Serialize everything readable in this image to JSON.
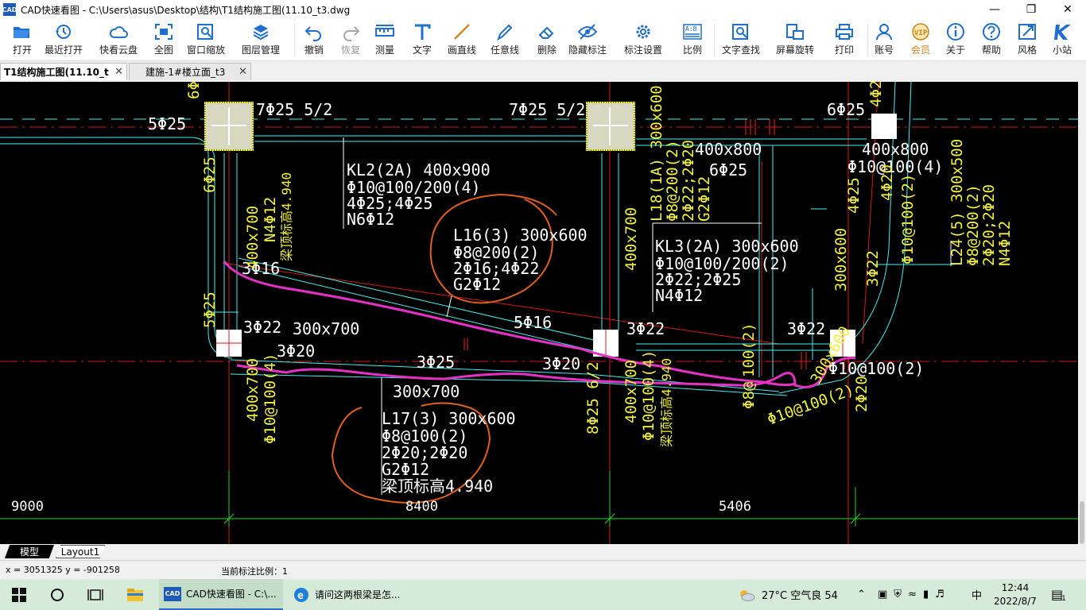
{
  "window": {
    "title": "CAD快速看图 - C:\\Users\\asus\\Desktop\\结构\\T1结构施工图(11.10_t3.dwg",
    "logo_text": "CAD"
  },
  "toolbar": [
    {
      "id": "open",
      "label": "打开",
      "icon": "folder-open-icon"
    },
    {
      "id": "recent",
      "label": "最近打开",
      "icon": "history-icon"
    },
    {
      "id": "cloud",
      "label": "快看云盘",
      "icon": "cloud-icon"
    },
    {
      "id": "fullview",
      "label": "全图",
      "icon": "fit-extents-icon"
    },
    {
      "id": "zoomwin",
      "label": "窗口缩放",
      "icon": "zoom-window-icon"
    },
    {
      "id": "layers",
      "label": "图层管理",
      "icon": "layers-icon"
    },
    {
      "id": "undo",
      "label": "撤销",
      "icon": "undo-icon"
    },
    {
      "id": "redo",
      "label": "恢复",
      "icon": "redo-icon",
      "disabled": true
    },
    {
      "id": "measure",
      "label": "测量",
      "icon": "ruler-icon"
    },
    {
      "id": "text",
      "label": "文字",
      "icon": "text-icon"
    },
    {
      "id": "line",
      "label": "画直线",
      "icon": "line-icon"
    },
    {
      "id": "freeline",
      "label": "任意线",
      "icon": "pen-icon"
    },
    {
      "id": "erase",
      "label": "删除",
      "icon": "eraser-icon"
    },
    {
      "id": "hidemarks",
      "label": "隐藏标注",
      "icon": "eye-hide-icon"
    },
    {
      "id": "marksettings",
      "label": "标注设置",
      "icon": "settings-icon"
    },
    {
      "id": "scale",
      "label": "比例",
      "icon": "scale-icon"
    },
    {
      "id": "findtext",
      "label": "文字查找",
      "icon": "find-text-icon"
    },
    {
      "id": "rotate",
      "label": "屏幕旋转",
      "icon": "rotate-screen-icon"
    },
    {
      "id": "print",
      "label": "打印",
      "icon": "printer-icon"
    },
    {
      "id": "account",
      "label": "账号",
      "icon": "user-icon"
    },
    {
      "id": "vip",
      "label": "会员",
      "icon": "vip-icon",
      "badge": "VIP"
    },
    {
      "id": "about",
      "label": "关于",
      "icon": "info-icon"
    },
    {
      "id": "help",
      "label": "帮助",
      "icon": "help-icon"
    },
    {
      "id": "style",
      "label": "风格",
      "icon": "style-icon"
    },
    {
      "id": "site",
      "label": "小站",
      "icon": "site-icon"
    }
  ],
  "scale_icon_text": "A:B",
  "tabs": [
    {
      "label": "T1结构施工图(11.10_t",
      "active": true
    },
    {
      "label": "建施-1#楼立面_t3",
      "active": false
    }
  ],
  "tab_close": "✕",
  "layout_tabs": {
    "model": "模型",
    "layout": "Layout1"
  },
  "status": {
    "coords": "x = 3051325  y = -901258",
    "scale": "当前标注比例：1"
  },
  "taskbar": {
    "apps": [
      {
        "label": "CAD快速看图 - C:\\...",
        "active": true
      },
      {
        "label": "请问这两根梁是怎...",
        "active": false
      }
    ],
    "weather": "27°C  空气良 54",
    "ime": "中",
    "time": "12:44",
    "date": "2022/8/7",
    "notif_count": "1"
  },
  "drawing": {
    "colors": {
      "cyan": "#3ff0f0",
      "yellow": "#f0f040",
      "white": "#ffffff",
      "red": "#d81818",
      "green": "#2ed02e",
      "magenta": "#e830c8",
      "orange": "#e0601a"
    },
    "white_labels": [
      {
        "t": "5Φ25"
      },
      {
        "t": "7Φ25 5/2"
      },
      {
        "t": "7Φ25 5/2"
      },
      {
        "t": "6Φ25"
      },
      {
        "t": "KL2(2A) 400x900"
      },
      {
        "t": "Φ10@100/200(4)"
      },
      {
        "t": "4Φ25;4Φ25"
      },
      {
        "t": "N6Φ12"
      },
      {
        "t": "L16(3) 300x600"
      },
      {
        "t": "Φ8@200(2)"
      },
      {
        "t": "2Φ16;4Φ22"
      },
      {
        "t": "G2Φ12"
      },
      {
        "t": "400x800"
      },
      {
        "t": "6Φ25"
      },
      {
        "t": "400x800"
      },
      {
        "t": "Φ10@100(4)"
      },
      {
        "t": "KL3(2A) 300x600"
      },
      {
        "t": "Φ10@100/200(2)"
      },
      {
        "t": "2Φ22;2Φ25"
      },
      {
        "t": "N4Φ12"
      },
      {
        "t": "3Φ16"
      },
      {
        "t": "5Φ16"
      },
      {
        "t": "3Φ22"
      },
      {
        "t": "300x700"
      },
      {
        "t": "3Φ20"
      },
      {
        "t": "3Φ22"
      },
      {
        "t": "3Φ22"
      },
      {
        "t": "3Φ25"
      },
      {
        "t": "3Φ20"
      },
      {
        "t": "300x700"
      },
      {
        "t": "Φ10@100(2)"
      },
      {
        "t": "L17(3) 300x600"
      },
      {
        "t": "Φ8@100(2)"
      },
      {
        "t": "2Φ20;2Φ20"
      },
      {
        "t": "G2Φ12"
      },
      {
        "t": "梁顶标高4.940"
      },
      {
        "t": "9000"
      },
      {
        "t": "8400"
      },
      {
        "t": "5406"
      }
    ],
    "yellow_labels": [
      {
        "t": "6Φ25"
      },
      {
        "t": "400x700"
      },
      {
        "t": "N4Φ12"
      },
      {
        "t": "梁顶标高4.940"
      },
      {
        "t": "6Φ25"
      },
      {
        "t": "L18(1A) 300x600"
      },
      {
        "t": "Φ8@200(2)"
      },
      {
        "t": "2Φ22;2Φ20"
      },
      {
        "t": "G2Φ12"
      },
      {
        "t": "400x700"
      },
      {
        "t": "L24(5) 300x500"
      },
      {
        "t": "Φ8@200(2)"
      },
      {
        "t": "2Φ20;2Φ20"
      },
      {
        "t": "N4Φ12"
      },
      {
        "t": "4Φ25"
      },
      {
        "t": "4Φ20"
      },
      {
        "t": "Φ10@100(2)"
      },
      {
        "t": "3Φ22"
      },
      {
        "t": "300x600"
      },
      {
        "t": "5Φ25"
      },
      {
        "t": "400x700"
      },
      {
        "t": "Φ10@100(4)"
      },
      {
        "t": "8Φ25 6/2"
      },
      {
        "t": "400x700"
      },
      {
        "t": "Φ10@100(4)"
      },
      {
        "t": "梁顶标高4.940"
      },
      {
        "t": "100(2)"
      },
      {
        "t": "Φ8@"
      },
      {
        "t": "Φ10@100(2)"
      },
      {
        "t": "2Φ20"
      },
      {
        "t": "300x600"
      },
      {
        "t": "4Φ2"
      }
    ]
  }
}
